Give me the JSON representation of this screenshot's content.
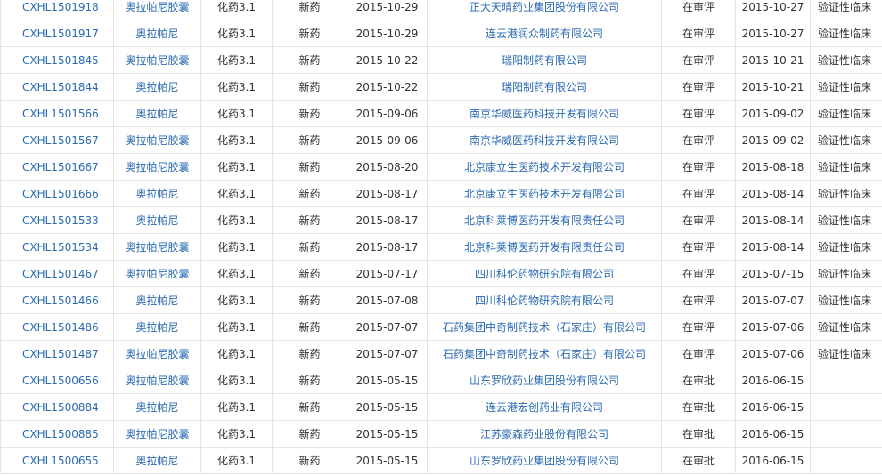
{
  "table": {
    "rows": [
      {
        "code": "CXHL1501918",
        "name": "奥拉帕尼胶囊",
        "category": "化药3.1",
        "type": "新药",
        "date": "2015-10-29",
        "company": "正大天晴药业集团股份有限公司",
        "status": "在审评",
        "status_date": "2015-10-27",
        "note": "验证性临床"
      },
      {
        "code": "CXHL1501917",
        "name": "奥拉帕尼",
        "category": "化药3.1",
        "type": "新药",
        "date": "2015-10-29",
        "company": "连云港润众制药有限公司",
        "status": "在审评",
        "status_date": "2015-10-27",
        "note": "验证性临床"
      },
      {
        "code": "CXHL1501845",
        "name": "奥拉帕尼胶囊",
        "category": "化药3.1",
        "type": "新药",
        "date": "2015-10-22",
        "company": "瑞阳制药有限公司",
        "status": "在审评",
        "status_date": "2015-10-21",
        "note": "验证性临床"
      },
      {
        "code": "CXHL1501844",
        "name": "奥拉帕尼",
        "category": "化药3.1",
        "type": "新药",
        "date": "2015-10-22",
        "company": "瑞阳制药有限公司",
        "status": "在审评",
        "status_date": "2015-10-21",
        "note": "验证性临床"
      },
      {
        "code": "CXHL1501566",
        "name": "奥拉帕尼",
        "category": "化药3.1",
        "type": "新药",
        "date": "2015-09-06",
        "company": "南京华威医药科技开发有限公司",
        "status": "在审评",
        "status_date": "2015-09-02",
        "note": "验证性临床"
      },
      {
        "code": "CXHL1501567",
        "name": "奥拉帕尼胶囊",
        "category": "化药3.1",
        "type": "新药",
        "date": "2015-09-06",
        "company": "南京华威医药科技开发有限公司",
        "status": "在审评",
        "status_date": "2015-09-02",
        "note": "验证性临床"
      },
      {
        "code": "CXHL1501667",
        "name": "奥拉帕尼胶囊",
        "category": "化药3.1",
        "type": "新药",
        "date": "2015-08-20",
        "company": "北京康立生医药技术开发有限公司",
        "status": "在审评",
        "status_date": "2015-08-18",
        "note": "验证性临床"
      },
      {
        "code": "CXHL1501666",
        "name": "奥拉帕尼",
        "category": "化药3.1",
        "type": "新药",
        "date": "2015-08-17",
        "company": "北京康立生医药技术开发有限公司",
        "status": "在审评",
        "status_date": "2015-08-14",
        "note": "验证性临床"
      },
      {
        "code": "CXHL1501533",
        "name": "奥拉帕尼",
        "category": "化药3.1",
        "type": "新药",
        "date": "2015-08-17",
        "company": "北京科莱博医药开发有限责任公司",
        "status": "在审评",
        "status_date": "2015-08-14",
        "note": "验证性临床"
      },
      {
        "code": "CXHL1501534",
        "name": "奥拉帕尼胶囊",
        "category": "化药3.1",
        "type": "新药",
        "date": "2015-08-17",
        "company": "北京科莱博医药开发有限责任公司",
        "status": "在审评",
        "status_date": "2015-08-14",
        "note": "验证性临床"
      },
      {
        "code": "CXHL1501467",
        "name": "奥拉帕尼胶囊",
        "category": "化药3.1",
        "type": "新药",
        "date": "2015-07-17",
        "company": "四川科伦药物研究院有限公司",
        "status": "在审评",
        "status_date": "2015-07-15",
        "note": "验证性临床"
      },
      {
        "code": "CXHL1501466",
        "name": "奥拉帕尼",
        "category": "化药3.1",
        "type": "新药",
        "date": "2015-07-08",
        "company": "四川科伦药物研究院有限公司",
        "status": "在审评",
        "status_date": "2015-07-07",
        "note": "验证性临床"
      },
      {
        "code": "CXHL1501486",
        "name": "奥拉帕尼",
        "category": "化药3.1",
        "type": "新药",
        "date": "2015-07-07",
        "company": "石药集团中奇制药技术（石家庄）有限公司",
        "status": "在审评",
        "status_date": "2015-07-06",
        "note": "验证性临床"
      },
      {
        "code": "CXHL1501487",
        "name": "奥拉帕尼胶囊",
        "category": "化药3.1",
        "type": "新药",
        "date": "2015-07-07",
        "company": "石药集团中奇制药技术（石家庄）有限公司",
        "status": "在审评",
        "status_date": "2015-07-06",
        "note": "验证性临床"
      },
      {
        "code": "CXHL1500656",
        "name": "奥拉帕尼胶囊",
        "category": "化药3.1",
        "type": "新药",
        "date": "2015-05-15",
        "company": "山东罗欣药业集团股份有限公司",
        "status": "在审批",
        "status_date": "2016-06-15",
        "note": ""
      },
      {
        "code": "CXHL1500884",
        "name": "奥拉帕尼",
        "category": "化药3.1",
        "type": "新药",
        "date": "2015-05-15",
        "company": "连云港宏创药业有限公司",
        "status": "在审批",
        "status_date": "2016-06-15",
        "note": ""
      },
      {
        "code": "CXHL1500885",
        "name": "奥拉帕尼胶囊",
        "category": "化药3.1",
        "type": "新药",
        "date": "2015-05-15",
        "company": "江苏豪森药业股份有限公司",
        "status": "在审批",
        "status_date": "2016-06-15",
        "note": ""
      },
      {
        "code": "CXHL1500655",
        "name": "奥拉帕尼",
        "category": "化药3.1",
        "type": "新药",
        "date": "2015-05-15",
        "company": "山东罗欣药业集团股份有限公司",
        "status": "在审批",
        "status_date": "2016-06-15",
        "note": ""
      }
    ]
  },
  "colors": {
    "link": "#2a6ab3",
    "text": "#333333",
    "border": "#e4e4e4"
  }
}
